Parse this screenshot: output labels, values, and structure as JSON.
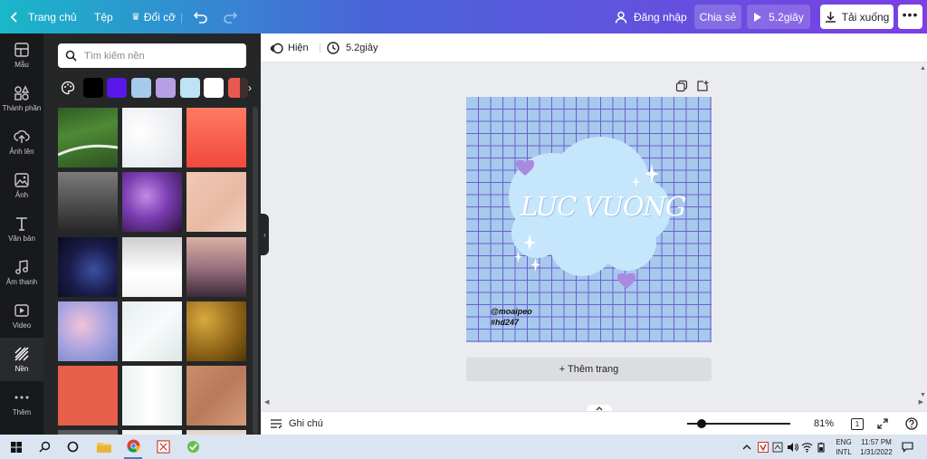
{
  "topbar": {
    "home": "Trang chủ",
    "file": "Tệp",
    "resize": "Đổi cỡ",
    "login": "Đăng nhập",
    "share": "Chia sẻ",
    "duration": "5.2giây",
    "download": "Tải xuống"
  },
  "rail": {
    "items": [
      {
        "label": "Mẫu",
        "icon": "template-icon"
      },
      {
        "label": "Thành phần",
        "icon": "elements-icon"
      },
      {
        "label": "Ảnh lên",
        "icon": "upload-icon"
      },
      {
        "label": "Ảnh",
        "icon": "photo-icon"
      },
      {
        "label": "Văn bản",
        "icon": "text-icon"
      },
      {
        "label": "Âm thanh",
        "icon": "music-icon"
      },
      {
        "label": "Video",
        "icon": "video-icon"
      },
      {
        "label": "Nền",
        "icon": "background-icon"
      },
      {
        "label": "Thêm",
        "icon": "more-icon"
      }
    ]
  },
  "panel": {
    "search_placeholder": "Tìm kiếm nền",
    "swatches": [
      "#000000",
      "#5b17e8",
      "#a7c9ec",
      "#b4a0e2",
      "#bfe2f5",
      "#ffffff",
      "#e85a4f"
    ]
  },
  "subbar": {
    "show": "Hiện",
    "duration": "5.2giây"
  },
  "canvas": {
    "title": "LUC VUONG",
    "handle": "@moaipeo",
    "tag": "#hd247",
    "add_page": "+ Thêm trang"
  },
  "bottombar": {
    "notes": "Ghi chú",
    "zoom": "81%",
    "page_count": "1"
  },
  "taskbar": {
    "lang_top": "ENG",
    "lang_bottom": "INTL",
    "time": "11:57 PM",
    "date": "1/31/2022"
  },
  "colors": {
    "canvas_bg": "#a7c9ec",
    "grid": "#6d5fd3",
    "cloud": "#c6e6fb",
    "heart": "#a98ae0"
  }
}
